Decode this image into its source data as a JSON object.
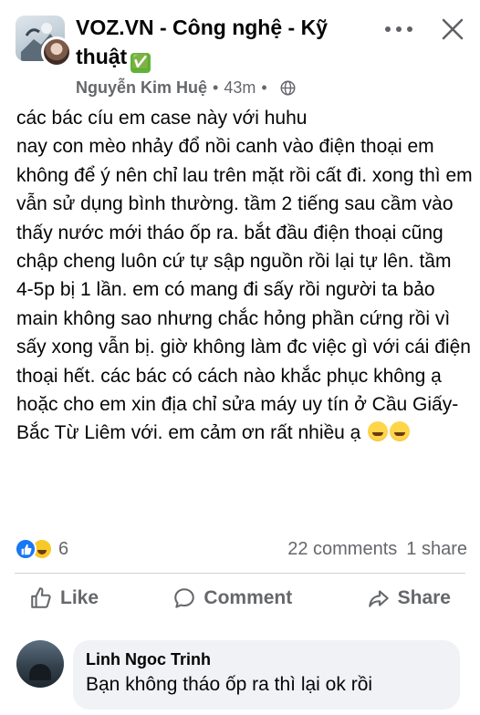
{
  "post": {
    "group_name": "VOZ.VN - Công nghệ - Kỹ thuật",
    "verified_emoji": "✅",
    "author": "Nguyễn Kim Huệ",
    "separator": "•",
    "time": "43m",
    "audience_icon": "globe-icon",
    "body": "các bác cíu em case này với huhu\nnay con mèo nhảy đổ nồi canh vào điện thoại em không để ý nên chỉ lau trên mặt rồi cất đi. xong thì em vẫn sử dụng bình thường. tầm 2 tiếng sau cầm vào thấy nước mới tháo ốp ra. bắt đầu điện thoại cũng chập cheng luôn cứ tự sập nguồn rồi lại tự lên. tầm 4-5p bị 1 lần. em có mang đi sấy rồi người ta bảo main không sao nhưng chắc hỏng phần cứng rồi vì sấy xong vẫn bị. giờ không làm đc việc gì với cái điện thoại hết. các bác có cách nào khắc phục không ạ hoặc cho em xin địa chỉ sửa máy uy tín ở Cầu Giấy-Bắc Từ Liêm với. em cảm ơn rất nhiều ạ",
    "body_emojis": [
      "sneezing-face-emoji",
      "sneezing-face-emoji"
    ]
  },
  "reactions": {
    "types": [
      "like",
      "haha"
    ],
    "count": "6",
    "comments": "22 comments",
    "shares": "1 share"
  },
  "actions": {
    "like": "Like",
    "comment": "Comment",
    "share": "Share"
  },
  "comment": {
    "author": "Linh Ngoc Trinh",
    "text": "Bạn không tháo ốp ra thì lại ok rồi"
  },
  "colors": {
    "text": "#050505",
    "secondary": "#65676b",
    "like_blue": "#1877f2",
    "verified_green": "#5cb735",
    "bubble": "#f0f2f5"
  }
}
